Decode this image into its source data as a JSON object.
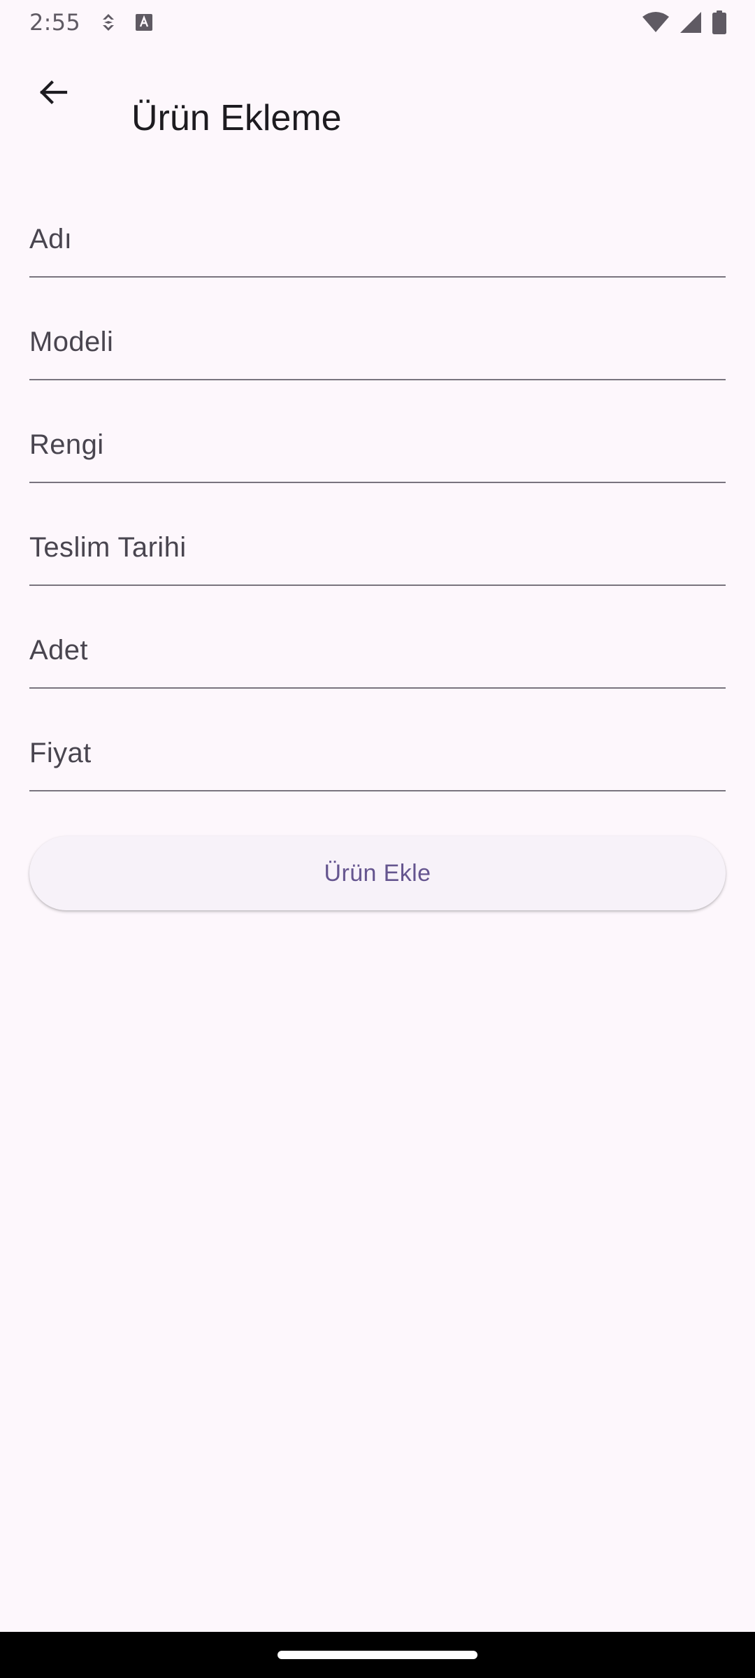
{
  "status_bar": {
    "time": "2:55",
    "left_icons": [
      "data-saver-icon",
      "text-a-icon"
    ],
    "right_icons": [
      "wifi-icon",
      "signal-icon",
      "battery-icon"
    ]
  },
  "app_bar": {
    "title": "Ürün Ekleme",
    "back_icon": "arrow-back-icon"
  },
  "form": {
    "fields": [
      {
        "name": "name",
        "placeholder": "Adı",
        "value": ""
      },
      {
        "name": "model",
        "placeholder": "Modeli",
        "value": ""
      },
      {
        "name": "color",
        "placeholder": "Rengi",
        "value": ""
      },
      {
        "name": "delivery-date",
        "placeholder": "Teslim Tarihi",
        "value": ""
      },
      {
        "name": "quantity",
        "placeholder": "Adet",
        "value": ""
      },
      {
        "name": "price",
        "placeholder": "Fiyat",
        "value": ""
      }
    ],
    "submit_label": "Ürün Ekle"
  },
  "colors": {
    "background": "#fdf7fc",
    "accent": "#65558f",
    "button_background": "#f7f2f9",
    "underline": "#79747e",
    "placeholder": "#49454f",
    "nav_bar": "#000000"
  }
}
